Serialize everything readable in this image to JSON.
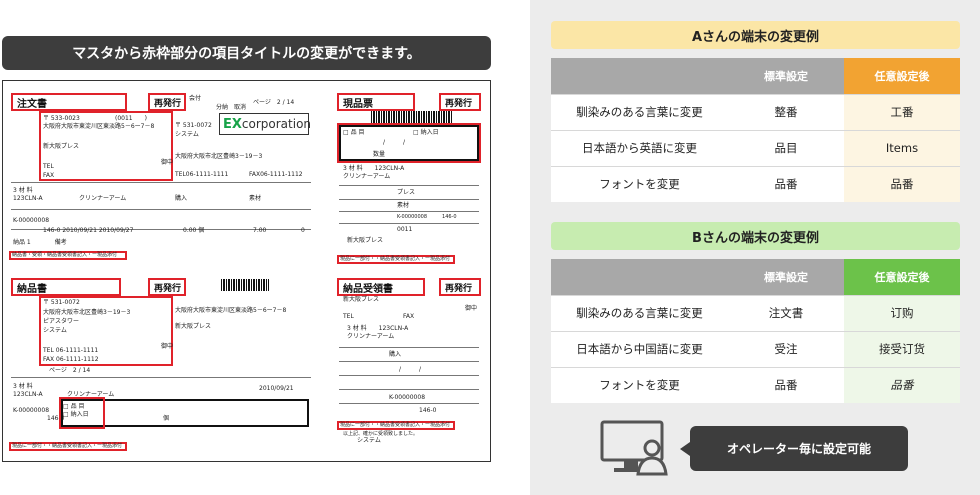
{
  "left": {
    "banner": "マスタから赤枠部分の項目タイトルの変更ができます。",
    "doc1": {
      "title": "注文書",
      "reissue": "再発行",
      "small_label": "会付",
      "page": "ページ　2 / 14",
      "postal": "〒 533-0023",
      "code": "(0011　　)",
      "address": "大阪府大阪市東淀川区東淡路5－6ー7－8",
      "partner": "新大阪プレス",
      "tel": "TEL",
      "fax": "FAX",
      "onchu": "御中",
      "split": "分納　取消",
      "to_postal": "〒 531-0072",
      "to_system": "システム",
      "to_address": "大阪府大阪市北区豊崎3－19－3",
      "to_tel": "TEL06-1111-1111",
      "to_fax": "FAX06-1111-1112",
      "row1": "3 材 料",
      "row1b": "123CLN-A",
      "item": "クリンナーアーム",
      "buy": "購入",
      "material": "素材",
      "order_no": "K-00000008",
      "date1": "146-0 2010/09/21 2010/09/27",
      "amount": "0.00 個",
      "price": "7.00",
      "zero": "0",
      "memo": "納品 1　　　　備考",
      "note": "納品書・受領・納品書受領書記入・ー現品添付"
    },
    "logo": {
      "ex": "EX",
      "corp": "corporation"
    },
    "doc2": {
      "title": "現品票",
      "reissue": "再発行",
      "check1": "□ 品 目",
      "check2": "□ 納入日",
      "slash": "/　　　/",
      "qty": "数量",
      "mat": "3 材 料　　123CLN-A",
      "item": "クリンナーアーム",
      "press": "プレス",
      "material": "素材",
      "order_no": "K-00000008　　　146-0",
      "code": "0011",
      "partner": "新大阪プレス",
      "note": "現品に一部付・・納品書受領書記入・ー現品添付"
    },
    "doc3": {
      "title": "納品書",
      "reissue": "再発行",
      "postal": "〒 531-0072",
      "address": "大阪府大阪市北区豊崎3－19－3",
      "building": "ピアスタワー",
      "system": "システム",
      "tel": "TEL 06-1111-1111",
      "fax": "FAX 06-1111-1112",
      "onchu": "御中",
      "from_address": "大阪府大阪市東淀川区東淡路5－6ー7－8",
      "from_name": "新大阪プレス",
      "page": "ページ　2 / 14",
      "mat": "3 材 料",
      "mat_code": "123CLN-A",
      "item": "クリンナーアーム",
      "date": "2010/09/21",
      "order_no": "K-00000008",
      "lot": "146-0",
      "check": "□ 品 目",
      "check2": "□ 納入日",
      "unit": "個",
      "note": "現品に一部付・・納品書受領書記入・ー現品添付"
    },
    "doc4": {
      "title": "納品受領書",
      "reissue": "再発行",
      "partner": "新大阪プレス",
      "onchu": "御中",
      "tel": "TEL",
      "fax": "FAX",
      "mat": "3 材 料　　123CLN-A",
      "item": "クリンナーアーム",
      "buy": "購入",
      "slash": "/　　　/",
      "order_no": "K-00000008",
      "lot": "146-0",
      "note": "現品に一部付・・納品書受領書記入・ー現品添付",
      "footer": "以上記、確かに受領致しました。",
      "system": "システム"
    }
  },
  "sectionA": {
    "title": "Aさんの端末の変更例",
    "headers": [
      "",
      "標準設定",
      "任意設定後"
    ],
    "rows": [
      [
        "馴染みのある言葉に変更",
        "整番",
        "工番"
      ],
      [
        "日本語から英語に変更",
        "品目",
        "Items"
      ],
      [
        "フォントを変更",
        "品番",
        "品番"
      ]
    ]
  },
  "sectionB": {
    "title": "Bさんの端末の変更例",
    "headers": [
      "",
      "標準設定",
      "任意設定後"
    ],
    "rows": [
      [
        "馴染みのある言葉に変更",
        "注文書",
        "订购"
      ],
      [
        "日本語から中国語に変更",
        "受注",
        "接受订货"
      ],
      [
        "フォントを変更",
        "品番",
        "品番"
      ]
    ]
  },
  "operator": "オペレーター毎に設定可能",
  "colors": {
    "accent_a": "#f2a332",
    "accent_b": "#6cc24a",
    "red_frame": "#e0222a",
    "dark": "#3d3d3d"
  }
}
